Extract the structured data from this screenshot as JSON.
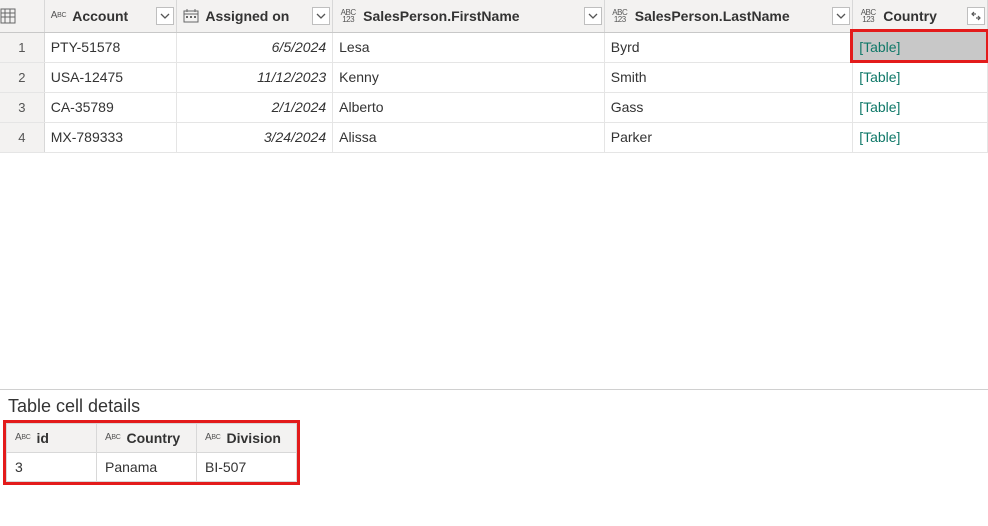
{
  "main_table": {
    "columns": [
      {
        "name": "Account",
        "type": "text"
      },
      {
        "name": "Assigned on",
        "type": "date"
      },
      {
        "name": "SalesPerson.FirstName",
        "type": "any"
      },
      {
        "name": "SalesPerson.LastName",
        "type": "any"
      },
      {
        "name": "Country",
        "type": "any",
        "expandable": true
      }
    ],
    "rows": [
      {
        "n": "1",
        "account": "PTY-51578",
        "assigned": "6/5/2024",
        "first": "Lesa",
        "last": "Byrd",
        "country": "[Table]",
        "selected": true
      },
      {
        "n": "2",
        "account": "USA-12475",
        "assigned": "11/12/2023",
        "first": "Kenny",
        "last": "Smith",
        "country": "[Table]"
      },
      {
        "n": "3",
        "account": "CA-35789",
        "assigned": "2/1/2024",
        "first": "Alberto",
        "last": "Gass",
        "country": "[Table]"
      },
      {
        "n": "4",
        "account": "MX-789333",
        "assigned": "3/24/2024",
        "first": "Alissa",
        "last": "Parker",
        "country": "[Table]"
      }
    ]
  },
  "details": {
    "title": "Table cell details",
    "columns": [
      {
        "name": "id",
        "type": "text"
      },
      {
        "name": "Country",
        "type": "text"
      },
      {
        "name": "Division",
        "type": "text"
      }
    ],
    "row": {
      "id": "3",
      "country": "Panama",
      "division": "BI-507"
    }
  }
}
